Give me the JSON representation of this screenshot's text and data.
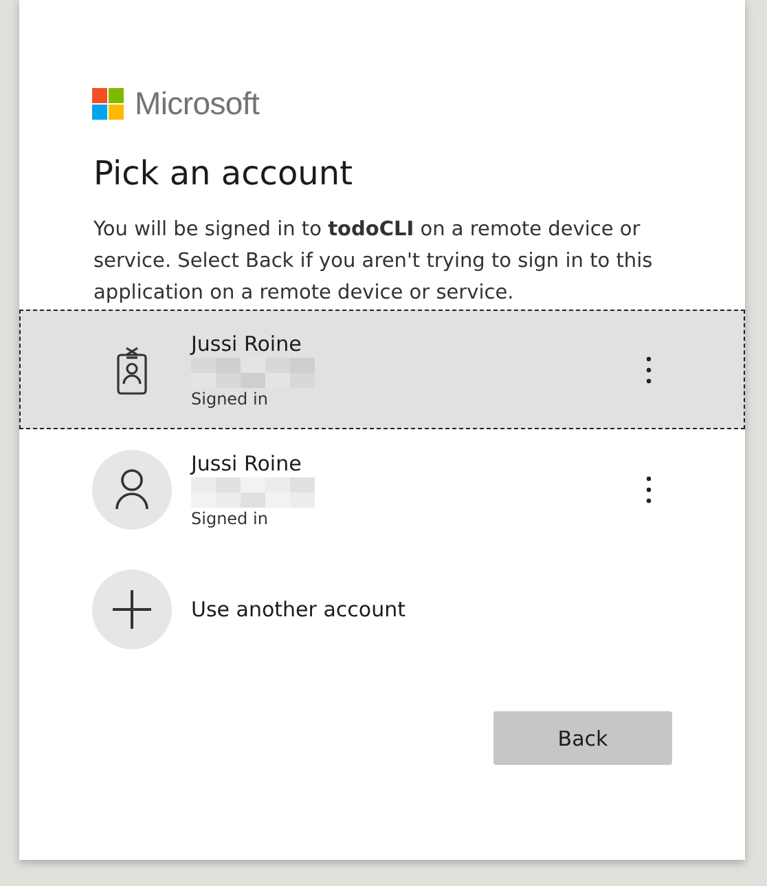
{
  "brand": {
    "name": "Microsoft"
  },
  "title": "Pick an account",
  "description": "You will be signed in to **todoCLI** on a remote device or service. Select Back if you aren't trying to sign in to this application on a remote device or service.",
  "accounts": [
    {
      "kind": "work",
      "name": "Jussi Roine",
      "status": "Signed in",
      "selected": true
    },
    {
      "kind": "personal",
      "name": "Jussi Roine",
      "status": "Signed in",
      "selected": false
    }
  ],
  "other_account": {
    "label": "Use another account"
  },
  "buttons": [
    {
      "label": "Back"
    }
  ]
}
